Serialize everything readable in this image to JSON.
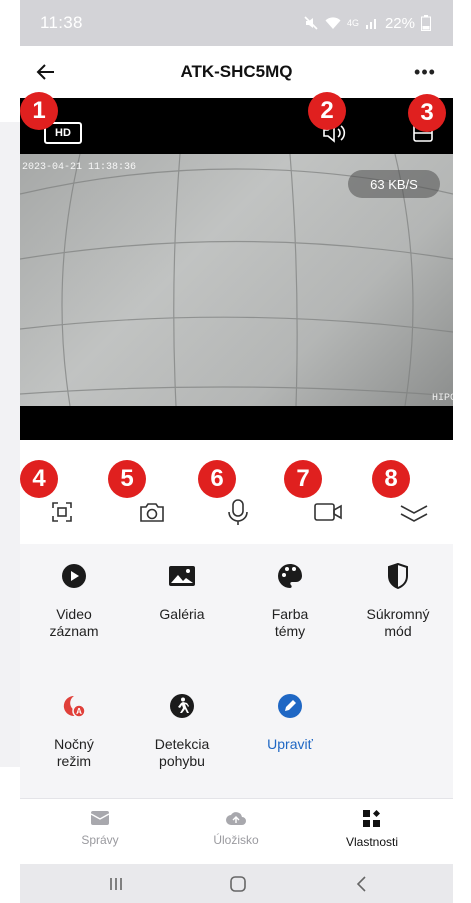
{
  "status_bar": {
    "time": "11:38",
    "signal_label": "4G",
    "battery": "22%"
  },
  "app_bar": {
    "title": "ATK-SHC5MQ",
    "more_label": "•••"
  },
  "video": {
    "quality_badge": "HD",
    "timestamp": "2023-04-21 11:38:36",
    "speed": "63 KB/S",
    "watermark": "HIPC"
  },
  "markers": [
    "1",
    "2",
    "3",
    "4",
    "5",
    "6",
    "7",
    "8"
  ],
  "controls": [
    {
      "name": "fullscreen-icon"
    },
    {
      "name": "camera-icon"
    },
    {
      "name": "microphone-icon"
    },
    {
      "name": "video-record-icon"
    },
    {
      "name": "collapse-icon"
    }
  ],
  "features": [
    {
      "label": "Video\nzáznam",
      "icon": "play-circle-icon"
    },
    {
      "label": "Galéria",
      "icon": "gallery-icon"
    },
    {
      "label": "Farba\ntémy",
      "icon": "palette-icon"
    },
    {
      "label": "Súkromný\nmód",
      "icon": "privacy-icon"
    },
    {
      "label": "Nočný\nrežim",
      "icon": "night-mode-icon"
    },
    {
      "label": "Detekcia\npohybu",
      "icon": "motion-detection-icon"
    },
    {
      "label": "Upraviť",
      "icon": "edit-icon"
    }
  ],
  "bottom_nav": [
    {
      "label": "Správy",
      "icon": "messages-icon"
    },
    {
      "label": "Úložisko",
      "icon": "cloud-storage-icon"
    },
    {
      "label": "Vlastnosti",
      "icon": "properties-icon"
    }
  ],
  "colors": {
    "marker": "#e0201f",
    "accent_blue": "#1f67c4",
    "night_red": "#e0403a"
  }
}
